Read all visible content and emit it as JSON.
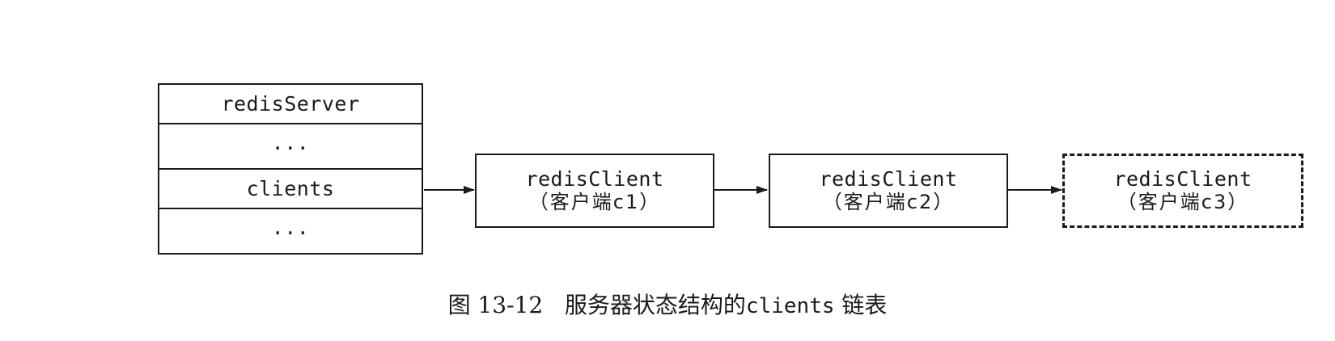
{
  "server": {
    "rows": [
      "redisServer",
      "...",
      "clients",
      "..."
    ]
  },
  "clients": [
    {
      "name": "redisClient",
      "note": "（客户端c1）",
      "dashed": false
    },
    {
      "name": "redisClient",
      "note": "（客户端c2）",
      "dashed": false
    },
    {
      "name": "redisClient",
      "note": "（客户端c3）",
      "dashed": true
    }
  ],
  "caption": {
    "figure_label": "图 13-12",
    "text_before": "服务器状态结构的",
    "code": "clients",
    "text_after": "链表"
  }
}
